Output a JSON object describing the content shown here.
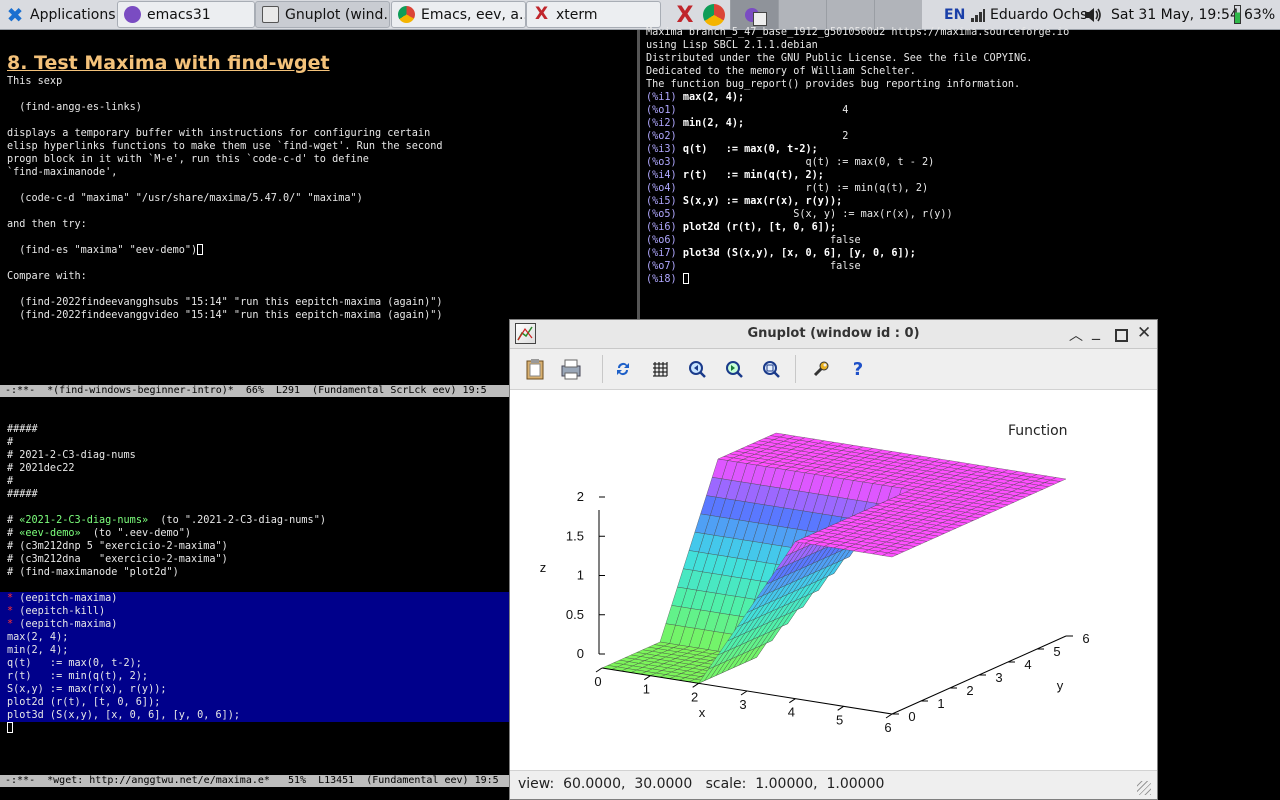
{
  "taskbar": {
    "apps_label": "Applications",
    "apps_separator": ":",
    "windows": [
      {
        "label": "emacs31",
        "icon": "emacs-icon"
      },
      {
        "label": "Gnuplot (wind...",
        "icon": "gnuplot-icon"
      },
      {
        "label": "Emacs, eev, a...",
        "icon": "chrome-icon"
      },
      {
        "label": "xterm",
        "icon": "xterm-icon"
      }
    ],
    "keyboard_layout": "EN",
    "user": "Eduardo Ochs",
    "clock": "Sat 31 May, 19:54",
    "battery": "63%"
  },
  "emacs_top": {
    "heading": "8. Test Maxima with find-wget",
    "body": "This sexp\n\n  (find-angg-es-links)\n\ndisplays a temporary buffer with instructions for configuring certain\nelisp hyperlinks functions to make them use `find-wget'. Run the second\nprogn block in it with `M-e', run this `code-c-d' to define\n`find-maximanode',\n\n  (code-c-d \"maxima\" \"/usr/share/maxima/5.47.0/\" \"maxima\")\n\nand then try:\n\n  (find-es \"maxima\" \"eev-demo\")",
    "body2": "Compare with:\n\n  (find-2022findeevangghsubs \"15:14\" \"run this eepitch-maxima (again)\")\n  (find-2022findeevanggvideo \"15:14\" \"run this eepitch-maxima (again)\")",
    "modeline": "-:**-  *(find-windows-beginner-intro)*  66%  L291  (Fundamental ScrLck eev) 19:5"
  },
  "emacs_bottom": {
    "header": "#####\n#\n# 2021-2-C3-diag-nums\n# 2021dec22\n#\n#####",
    "links": [
      {
        "pre": "# ",
        "anchor": "«2021-2-C3-diag-nums»",
        "post": "  (to \".2021-2-C3-diag-nums\")"
      },
      {
        "pre": "# ",
        "anchor": "«eev-demo»",
        "post": "  (to \".eev-demo\")"
      }
    ],
    "comments": "# (c3m212dnp 5 \"exercicio-2-maxima\")\n# (c3m212dna   \"exercicio-2-maxima\")\n# (find-maximanode \"plot2d\")",
    "star_lines": [
      " (eepitch-maxima)",
      " (eepitch-kill)",
      " (eepitch-maxima)"
    ],
    "code": "max(2, 4);\nmin(2, 4);\nq(t)   := max(0, t-2);\nr(t)   := min(q(t), 2);\nS(x,y) := max(r(x), r(y));\nplot2d (r(t), [t, 0, 6]);\nplot3d (S(x,y), [x, 0, 6], [y, 0, 6]);",
    "modeline": "-:**-  *wget: http://anggtwu.net/e/maxima.e*   51%  L13451  (Fundamental eev) 19:5"
  },
  "maxima": {
    "header": "Maxima branch_5_47_base_1912_g5010560d2 https://maxima.sourceforge.io\nusing Lisp SBCL 2.1.1.debian\nDistributed under the GNU Public License. See the file COPYING.\nDedicated to the memory of William Schelter.\nThe function bug_report() provides bug reporting information.",
    "lines": [
      {
        "label": "(%i1) ",
        "text": "max(2, 4);",
        "kind": "in"
      },
      {
        "label": "(%o1) ",
        "text": "                          4",
        "kind": "out"
      },
      {
        "label": "(%i2) ",
        "text": "min(2, 4);",
        "kind": "in"
      },
      {
        "label": "(%o2) ",
        "text": "                          2",
        "kind": "out"
      },
      {
        "label": "(%i3) ",
        "text": "q(t)   := max(0, t-2);",
        "kind": "in"
      },
      {
        "label": "(%o3) ",
        "text": "                    q(t) := max(0, t - 2)",
        "kind": "out"
      },
      {
        "label": "(%i4) ",
        "text": "r(t)   := min(q(t), 2);",
        "kind": "in"
      },
      {
        "label": "(%o4) ",
        "text": "                    r(t) := min(q(t), 2)",
        "kind": "out"
      },
      {
        "label": "(%i5) ",
        "text": "S(x,y) := max(r(x), r(y));",
        "kind": "in"
      },
      {
        "label": "(%o5) ",
        "text": "                  S(x, y) := max(r(x), r(y))",
        "kind": "out"
      },
      {
        "label": "(%i6) ",
        "text": "plot2d (r(t), [t, 0, 6]);",
        "kind": "in"
      },
      {
        "label": "(%o6) ",
        "text": "                        false",
        "kind": "out"
      },
      {
        "label": "(%i7) ",
        "text": "plot3d (S(x,y), [x, 0, 6], [y, 0, 6]);",
        "kind": "in"
      },
      {
        "label": "(%o7) ",
        "text": "                        false",
        "kind": "out"
      }
    ],
    "prompt": "(%i8) "
  },
  "gnuplot": {
    "title": "Gnuplot (window id : 0)",
    "legend": "Function",
    "status": "view:  60.0000,  30.0000   scale:  1.00000,  1.00000",
    "z_label": "z",
    "x_label": "x",
    "y_label": "y",
    "z_ticks": [
      "2",
      "1.5",
      "1",
      "0.5",
      "0"
    ],
    "x_ticks": [
      "0",
      "1",
      "2",
      "3",
      "4",
      "5",
      "6"
    ],
    "y_ticks": [
      "0",
      "1",
      "2",
      "3",
      "4",
      "5",
      "6"
    ],
    "surface_colors": {
      "low": "#7cf55a",
      "mid": "#3fe6d0",
      "high": "#ff4fff"
    }
  }
}
